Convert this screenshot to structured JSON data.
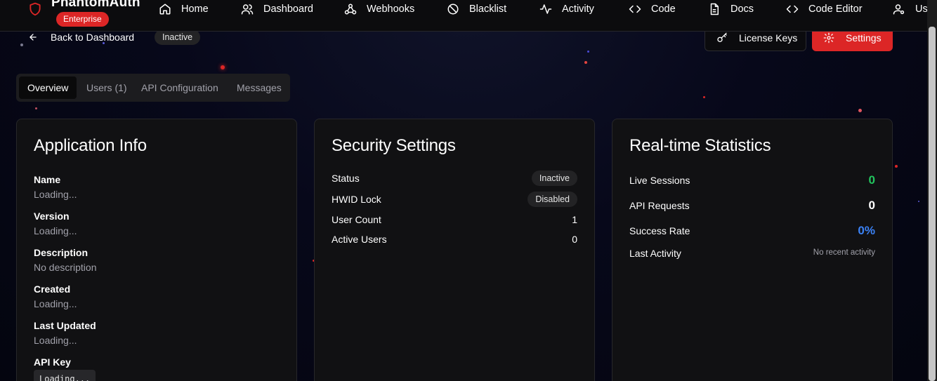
{
  "nav": {
    "brand": "PhantomAuth",
    "badge": "Enterprise",
    "items": [
      {
        "label": "Home",
        "icon": "home-icon"
      },
      {
        "label": "Dashboard",
        "icon": "users-icon"
      },
      {
        "label": "Webhooks",
        "icon": "webhook-icon"
      },
      {
        "label": "Blacklist",
        "icon": "ban-icon"
      },
      {
        "label": "Activity",
        "icon": "activity-icon"
      },
      {
        "label": "Code",
        "icon": "code-icon"
      },
      {
        "label": "Docs",
        "icon": "file-icon"
      },
      {
        "label": "Code Editor",
        "icon": "code-icon"
      },
      {
        "label": "Us",
        "icon": "user-cog-icon"
      }
    ]
  },
  "header": {
    "back_label": "Back to Dashboard",
    "status": "Inactive",
    "license_keys_label": "License Keys",
    "settings_label": "Settings"
  },
  "tabs": [
    "Overview",
    "Users (1)",
    "API Configuration",
    "Messages"
  ],
  "app_info": {
    "title": "Application Info",
    "fields": [
      {
        "label": "Name",
        "value": "Loading..."
      },
      {
        "label": "Version",
        "value": "Loading..."
      },
      {
        "label": "Description",
        "value": "No description"
      },
      {
        "label": "Created",
        "value": "Loading..."
      },
      {
        "label": "Last Updated",
        "value": "Loading..."
      },
      {
        "label": "API Key",
        "value": "Loading..."
      }
    ]
  },
  "security": {
    "title": "Security Settings",
    "rows": [
      {
        "label": "Status",
        "value": "Inactive"
      },
      {
        "label": "HWID Lock",
        "value": "Disabled"
      },
      {
        "label": "User Count",
        "value": "1"
      },
      {
        "label": "Active Users",
        "value": "0"
      }
    ]
  },
  "stats": {
    "title": "Real-time Statistics",
    "rows": [
      {
        "label": "Live Sessions",
        "value": "0",
        "color": "#22c55e"
      },
      {
        "label": "API Requests",
        "value": "0",
        "color": "#ffffff"
      },
      {
        "label": "Success Rate",
        "value": "0%",
        "color": "#3b82f6"
      },
      {
        "label": "Last Activity",
        "value": "No recent activity",
        "color": "#a1a1aa"
      }
    ]
  },
  "colors": {
    "accent": "#dc2626",
    "card_bg": "#111113",
    "nav_bg": "#0c0c0e"
  }
}
